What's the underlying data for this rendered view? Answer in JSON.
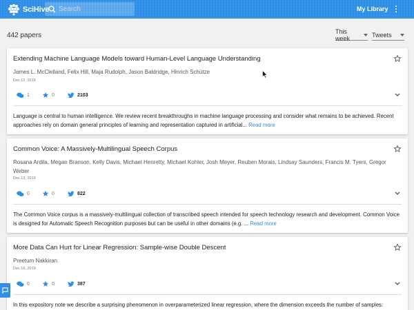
{
  "header": {
    "logo_text": "SciHive",
    "search_placeholder": "Search",
    "my_library": "My Library"
  },
  "toolbar": {
    "paper_count": "442 papers",
    "period": "This week",
    "sort": "Tweets"
  },
  "papers": [
    {
      "title": "Extending Machine Language Models toward Human-Level Language Understanding",
      "authors": "James L. McClelland, Felix Hill, Maja Rudolph, Jason Baldridge, Hinrich Schütze",
      "date": "Dec 12, 2019",
      "comments": "1",
      "likes": "0",
      "tweets": "2103",
      "abstract": "Language is central to human intelligence. We review recent breakthroughs in machine language processing and consider what remains to be achieved. Recent approaches rely on domain general principles of learning and representation captured in artificial...",
      "read_more": "Read more"
    },
    {
      "title": "Common Voice: A Massively-Multilingual Speech Corpus",
      "authors": "Rosana Ardila, Megan Branson, Kelly Davis, Michael Henretty, Michael Kohler, Josh Meyer, Reuben Morais, Lindsay Saunders, Francis M. Tyers, Gregor Weber",
      "date": "Dec 13, 2019",
      "comments": "0",
      "likes": "0",
      "tweets": "822",
      "abstract": "The Common Voice corpus is a massively-multilingual collection of transcribed speech intended for speech technology research and development. Common Voice is designed for Automatic Speech Recognition purposes but can be useful in other domains (e.g. ...",
      "read_more": "Read more"
    },
    {
      "title": "More Data Can Hurt for Linear Regression: Sample-wise Double Descent",
      "authors": "Preetum Nakkiran",
      "date": "Dec 16, 2019",
      "comments": "0",
      "likes": "0",
      "tweets": "387",
      "abstract": "In this expository note we describe a surprising phenomenon in overparameterized linear regression, where the dimension exceeds the number of samples:",
      "read_more": ""
    }
  ],
  "colors": {
    "brand": "#2f8ee6",
    "star_outline": "#666666"
  }
}
